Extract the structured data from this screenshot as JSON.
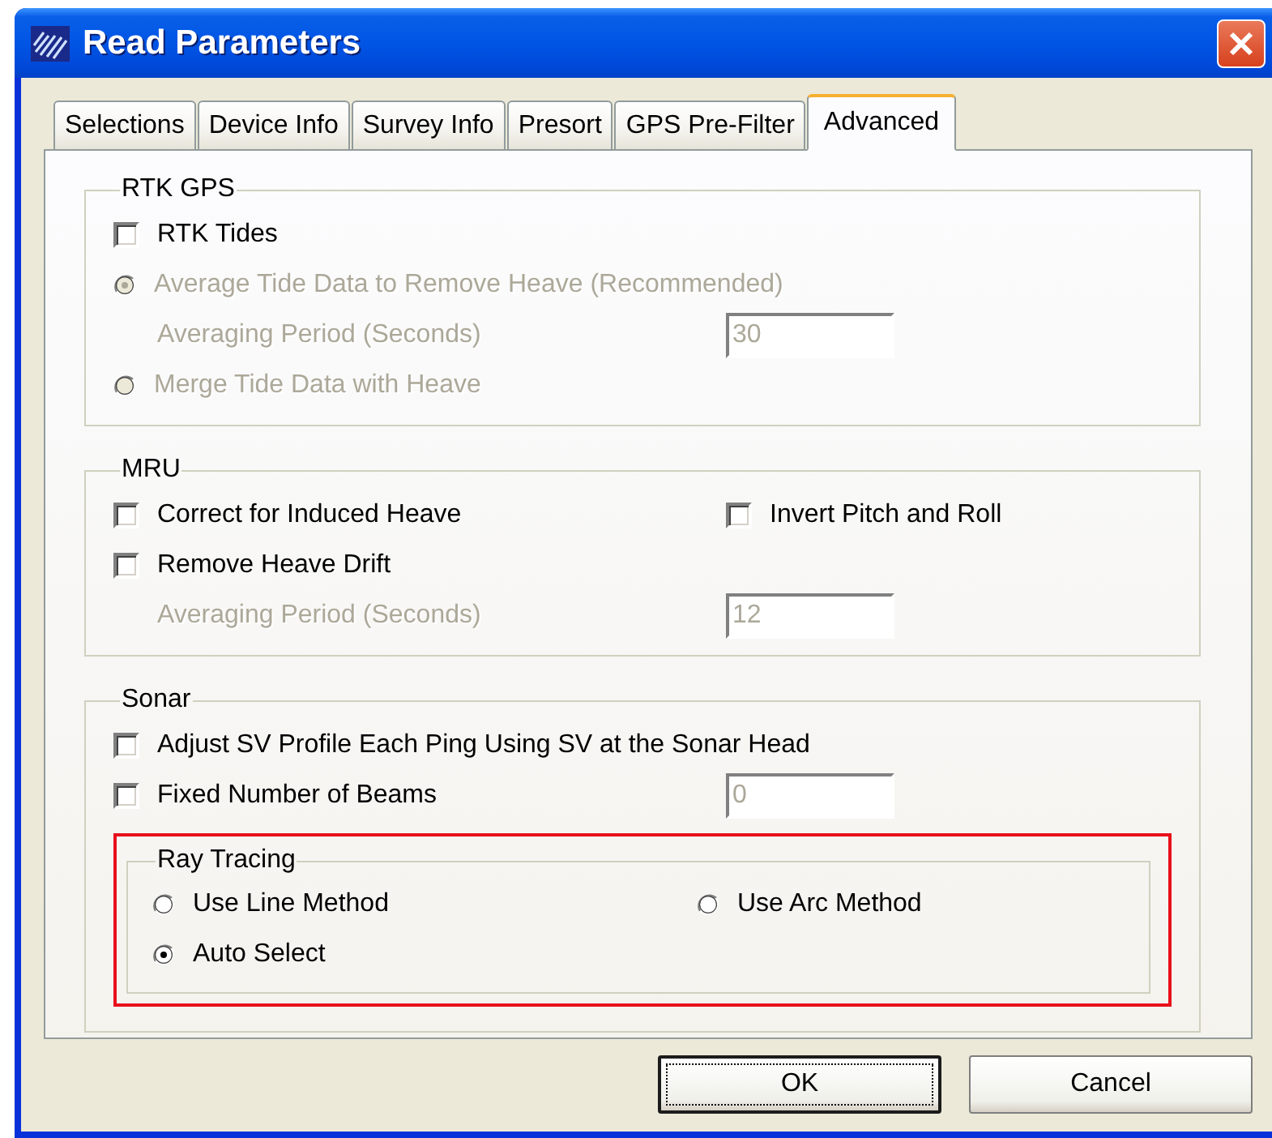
{
  "window": {
    "title": "Read Parameters"
  },
  "tabs": [
    {
      "label": "Selections",
      "selected": false
    },
    {
      "label": "Device Info",
      "selected": false
    },
    {
      "label": "Survey Info",
      "selected": false
    },
    {
      "label": "Presort",
      "selected": false
    },
    {
      "label": "GPS Pre-Filter",
      "selected": false
    },
    {
      "label": "Advanced",
      "selected": true
    }
  ],
  "groups": [
    {
      "title": "RTK GPS",
      "rows": [
        [
          {
            "kind": "checkbox",
            "label": "RTK Tides",
            "checked": false,
            "disabled": false
          }
        ],
        [
          {
            "kind": "radio",
            "label": "Average Tide Data to Remove Heave (Recommended)",
            "selected": true,
            "disabled": true
          }
        ],
        [
          {
            "kind": "label",
            "label": "Averaging Period (Seconds)",
            "disabled": true
          },
          {
            "kind": "input",
            "value": "30",
            "disabled": true
          }
        ],
        [
          {
            "kind": "radio",
            "label": "Merge Tide Data with Heave",
            "selected": false,
            "disabled": true
          }
        ]
      ]
    },
    {
      "title": "MRU",
      "rows": [
        [
          {
            "kind": "checkbox",
            "label": "Correct for Induced Heave",
            "checked": false,
            "disabled": false
          },
          {
            "kind": "checkbox",
            "label": "Invert Pitch and Roll",
            "checked": false,
            "disabled": false
          }
        ],
        [
          {
            "kind": "checkbox",
            "label": "Remove Heave Drift",
            "checked": false,
            "disabled": false
          }
        ],
        [
          {
            "kind": "label",
            "label": "Averaging Period (Seconds)",
            "disabled": true
          },
          {
            "kind": "input",
            "value": "12",
            "disabled": true
          }
        ]
      ]
    },
    {
      "title": "Sonar",
      "rows": [
        [
          {
            "kind": "checkbox",
            "label": "Adjust SV Profile Each Ping Using SV at the Sonar Head",
            "checked": false,
            "disabled": false
          }
        ],
        [
          {
            "kind": "checkbox",
            "label": "Fixed Number of Beams",
            "checked": false,
            "disabled": false
          },
          {
            "kind": "input",
            "value": "0",
            "disabled": true
          }
        ]
      ],
      "subgroups": [
        {
          "title": "Ray Tracing",
          "highlighted": true,
          "rows": [
            [
              {
                "kind": "radio",
                "label": "Use Line Method",
                "selected": false,
                "disabled": false
              },
              {
                "kind": "radio",
                "label": "Use Arc Method",
                "selected": false,
                "disabled": false
              }
            ],
            [
              {
                "kind": "radio",
                "label": "Auto Select",
                "selected": true,
                "disabled": false
              }
            ]
          ]
        }
      ]
    }
  ],
  "buttons": [
    {
      "label": "OK",
      "default": true
    },
    {
      "label": "Cancel",
      "default": false
    }
  ]
}
